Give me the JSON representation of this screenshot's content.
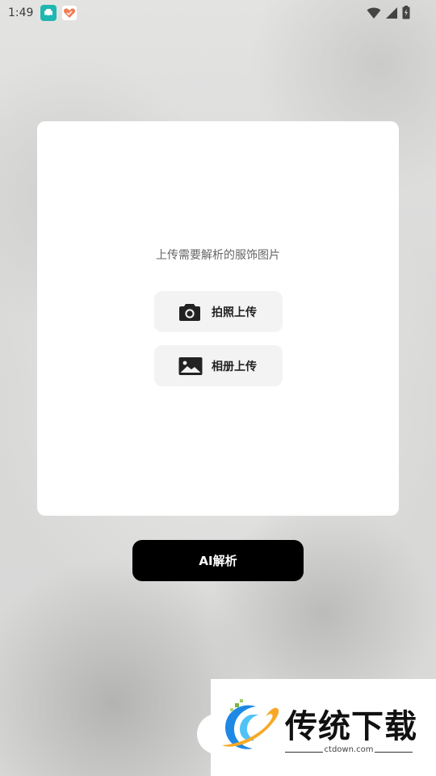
{
  "status_bar": {
    "time": "1:49",
    "notification_icons": [
      "car-app-icon",
      "heart-app-icon"
    ],
    "system_icons": [
      "wifi-icon",
      "signal-icon",
      "battery-icon"
    ]
  },
  "upload_card": {
    "hint": "上传需要解析的服饰图片",
    "camera_button": {
      "label": "拍照上传",
      "icon": "camera-icon"
    },
    "album_button": {
      "label": "相册上传",
      "icon": "image-icon"
    }
  },
  "analyze_button": {
    "label": "AI解析"
  },
  "watermark": {
    "title": "传统下载",
    "url": "ctdown.com"
  },
  "colors": {
    "card_bg": "#ffffff",
    "button_bg": "#f3f3f3",
    "primary_button": "#000000",
    "teal_app": "#1fb7b1",
    "orange_app": "#f07d55"
  }
}
